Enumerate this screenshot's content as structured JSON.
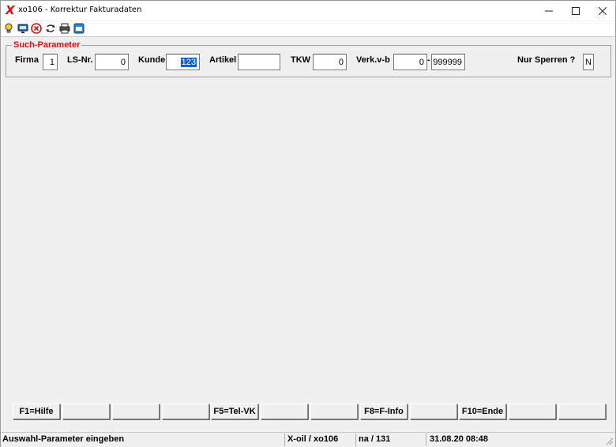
{
  "window": {
    "title": "xo106 - Korrektur Fakturadaten",
    "app_icon": "X",
    "controls": {
      "minimize": "—",
      "maximize": "☐",
      "close": "✕"
    }
  },
  "toolbar": {
    "icons": [
      "lightbulb-icon",
      "monitor-icon",
      "cancel-icon",
      "refresh-icon",
      "printer-icon",
      "window-icon"
    ]
  },
  "search": {
    "legend": "Such-Parameter",
    "fields": {
      "firma": {
        "label": "Firma",
        "value": "1"
      },
      "ls_nr": {
        "label": "LS-Nr.",
        "value": "0"
      },
      "kunde": {
        "label": "Kunde",
        "value": "123"
      },
      "artikel": {
        "label": "Artikel",
        "value": ""
      },
      "tkw": {
        "label": "TKW",
        "value": "0"
      },
      "verk": {
        "label": "Verk.v-b",
        "value_from": "0",
        "separator": "-",
        "value_to": "999999"
      },
      "nur_sperren": {
        "label": "Nur Sperren ?",
        "value": "N"
      }
    }
  },
  "fkeys": [
    "F1=Hilfe",
    "",
    "",
    "",
    "F5=Tel-VK",
    "",
    "",
    "F8=F-Info",
    "",
    "F10=Ende",
    "",
    ""
  ],
  "status": {
    "message": "Auswahl-Parameter eingeben",
    "program": "X-oil / xo106",
    "user": "na / 131",
    "datetime": "31.08.20 08:48"
  },
  "colors": {
    "legend": "#d01010",
    "selection": "#0a62c9",
    "app_icon": "#e01010"
  }
}
